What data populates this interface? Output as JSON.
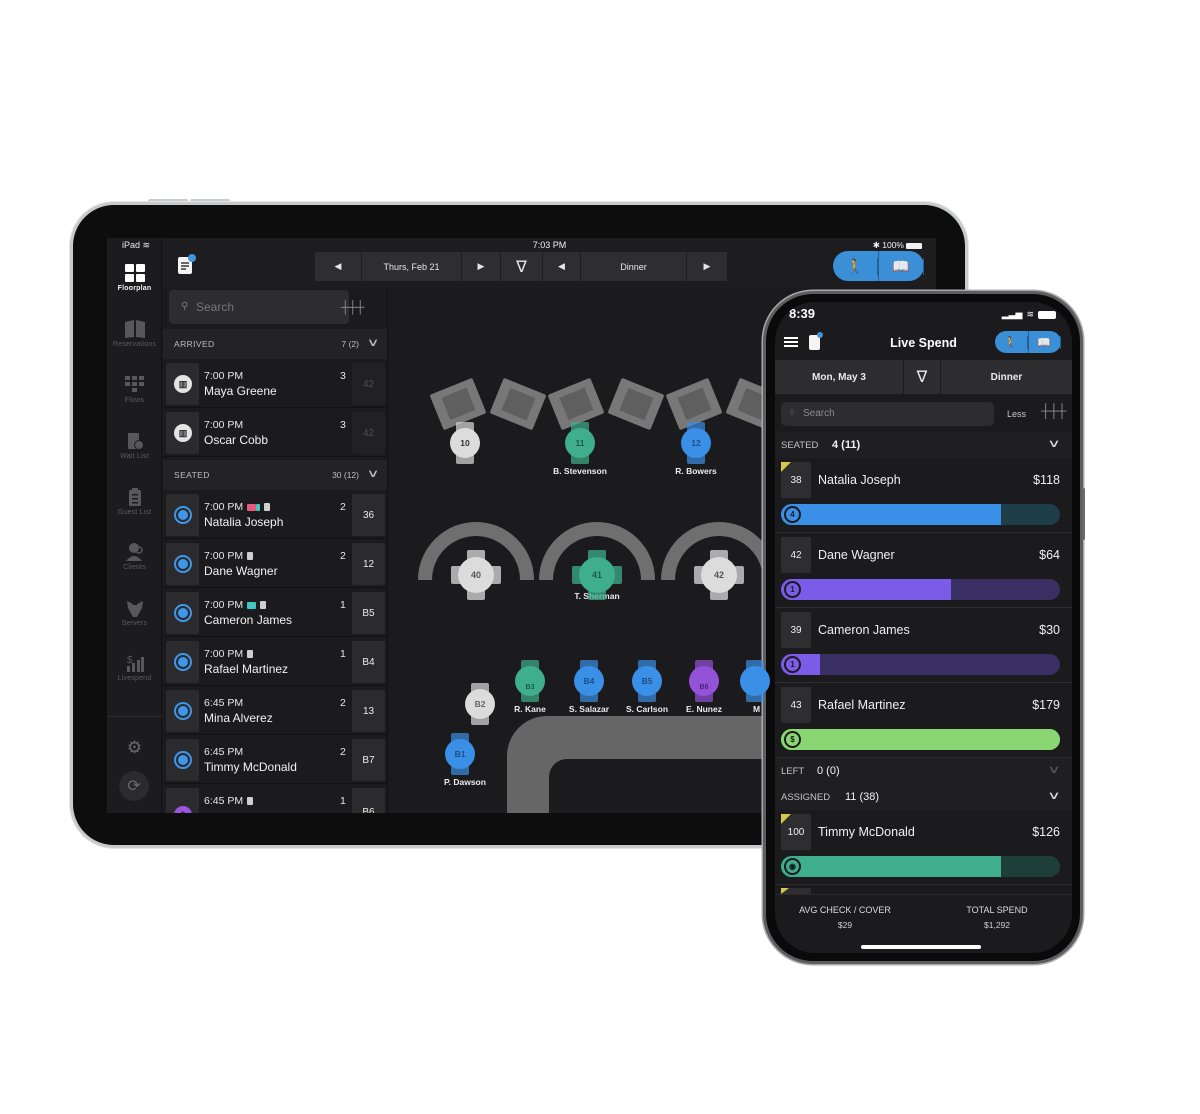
{
  "ipad": {
    "status": {
      "device": "iPad",
      "time": "7:03 PM",
      "battery": "100%"
    },
    "rail": [
      {
        "label": "Floorplan",
        "icon": "floorplan-icon",
        "active": true
      },
      {
        "label": "Reservations",
        "icon": "book-icon"
      },
      {
        "label": "Flows",
        "icon": "flows-icon"
      },
      {
        "label": "Wait List",
        "icon": "waitlist-icon"
      },
      {
        "label": "Guest List",
        "icon": "clipboard-icon"
      },
      {
        "label": "Clients",
        "icon": "clients-icon"
      },
      {
        "label": "Servers",
        "icon": "server-icon"
      },
      {
        "label": "Livespend",
        "icon": "livespend-icon"
      }
    ],
    "toolbar": {
      "date": "Thurs, Feb 21",
      "shift": "Dinner",
      "prev_glyph": "◀",
      "next_glyph": "▶",
      "filter_glyph": "∇"
    },
    "search": {
      "placeholder": "Search"
    },
    "sections": {
      "arrived": {
        "title": "ARRIVED",
        "count": "7 (2)"
      },
      "seated": {
        "title": "SEATED",
        "count": "30 (12)"
      }
    },
    "arrived_rows": [
      {
        "time": "7:00 PM",
        "name": "Maya Greene",
        "covers": "3",
        "table": "42"
      },
      {
        "time": "7:00 PM",
        "name": "Oscar Cobb",
        "covers": "3",
        "table": "42"
      }
    ],
    "seated_rows": [
      {
        "time": "7:00 PM",
        "name": "Natalia Joseph",
        "covers": "2",
        "table": "36"
      },
      {
        "time": "7:00 PM",
        "name": "Dane Wagner",
        "covers": "2",
        "table": "12"
      },
      {
        "time": "7:00 PM",
        "name": "Cameron James",
        "covers": "1",
        "table": "B5"
      },
      {
        "time": "7:00 PM",
        "name": "Rafael Martinez",
        "covers": "1",
        "table": "B4"
      },
      {
        "time": "6:45 PM",
        "name": "Mina Alverez",
        "covers": "2",
        "table": "13"
      },
      {
        "time": "6:45 PM",
        "name": "Timmy McDonald",
        "covers": "2",
        "table": "B7"
      },
      {
        "time": "6:45 PM",
        "name": "",
        "covers": "1",
        "table": "B6"
      }
    ],
    "floor": {
      "tables": [
        {
          "id": "10",
          "label": ""
        },
        {
          "id": "11",
          "label": "B. Stevenson"
        },
        {
          "id": "12",
          "label": "R. Bowers"
        },
        {
          "id": "40",
          "label": ""
        },
        {
          "id": "41",
          "label": "T. Sherman"
        },
        {
          "id": "42",
          "label": ""
        },
        {
          "id": "B1",
          "label": "P. Dawson"
        },
        {
          "id": "B2",
          "label": ""
        },
        {
          "id": "B3",
          "label": "R. Kane"
        },
        {
          "id": "B4",
          "label": "S. Salazar"
        },
        {
          "id": "B5",
          "label": "S. Carlson"
        },
        {
          "id": "B6",
          "label": "E. Nunez"
        },
        {
          "id": "",
          "label": "M"
        }
      ]
    }
  },
  "phone": {
    "status": {
      "time": "8:39"
    },
    "title": "Live Spend",
    "filter": {
      "date": "Mon, May 3",
      "shift": "Dinner",
      "filter_glyph": "∇"
    },
    "search": {
      "placeholder": "Search",
      "less_label": "Less"
    },
    "sections": {
      "seated": {
        "title": "SEATED",
        "count": "4 (11)"
      },
      "left": {
        "title": "LEFT",
        "count": "0 (0)"
      },
      "assigned": {
        "title": "ASSIGNED",
        "count": "11 (38)"
      }
    },
    "seated_items": [
      {
        "table": "38",
        "name": "Natalia Joseph",
        "amount": "$118",
        "badge": "4",
        "progress": 0.79,
        "color": "#3a8fe6",
        "track": "#1e3e4a",
        "flag": true
      },
      {
        "table": "42",
        "name": "Dane Wagner",
        "amount": "$64",
        "badge": "1",
        "progress": 0.61,
        "color": "#7a5ce8",
        "track": "#3a2f62",
        "flag": false
      },
      {
        "table": "39",
        "name": "Cameron James",
        "amount": "$30",
        "badge": "1",
        "progress": 0.14,
        "color": "#7a5ce8",
        "track": "#3a2f62",
        "flag": false
      },
      {
        "table": "43",
        "name": "Rafael Martinez",
        "amount": "$179",
        "badge": "$",
        "progress": 1.0,
        "color": "#8ad672",
        "track": "#8ad672",
        "flag": false
      }
    ],
    "assigned_items": [
      {
        "table": "100",
        "name": "Timmy McDonald",
        "amount": "$126",
        "badge": "◉",
        "progress": 0.79,
        "color": "#3fae8c",
        "track": "#1e3e3a",
        "flag": true
      }
    ],
    "footer": {
      "avg_label": "AVG CHECK / COVER",
      "avg_value": "$29",
      "total_label": "TOTAL SPEND",
      "total_value": "$1,292"
    }
  }
}
